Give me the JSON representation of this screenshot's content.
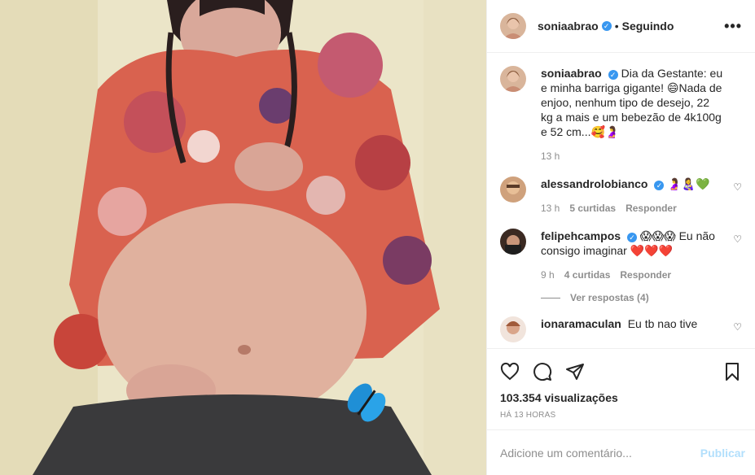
{
  "post": {
    "image_alt": "Foto de gestante vestindo blusa florida com a barriga à mostra",
    "author": "soniaabrao",
    "following_label": "Seguindo",
    "more_label": "•••"
  },
  "caption": {
    "user": "soniaabrao",
    "text": "Dia da Gestante: eu e minha barriga gigante! 😄Nada de enjoo, nenhum tipo de desejo, 22 kg a mais e um bebezão de 4k100g e 52 cm...🥰🤰",
    "time": "13 h"
  },
  "comments": [
    {
      "user": "alessandrolobianco",
      "text": "🤰👩‍🍼💚",
      "time": "13 h",
      "likes": "5 curtidas",
      "reply": "Responder"
    },
    {
      "user": "felipehcampos",
      "text": "😱😱😱 Eu não consigo imaginar ❤️❤️❤️",
      "time": "9 h",
      "likes": "4 curtidas",
      "reply": "Responder",
      "view_replies": "Ver respostas (4)"
    },
    {
      "user": "ionaramaculan",
      "text": "Eu tb nao tive"
    }
  ],
  "stats": {
    "views": "103.354 visualizações",
    "posted": "HÁ 13 HORAS"
  },
  "add_comment": {
    "placeholder": "Adicione um comentário...",
    "publish": "Publicar"
  },
  "colors": {
    "link": "#3897f0",
    "publish_disabled": "#b2dffc",
    "muted": "#8e8e8e"
  }
}
